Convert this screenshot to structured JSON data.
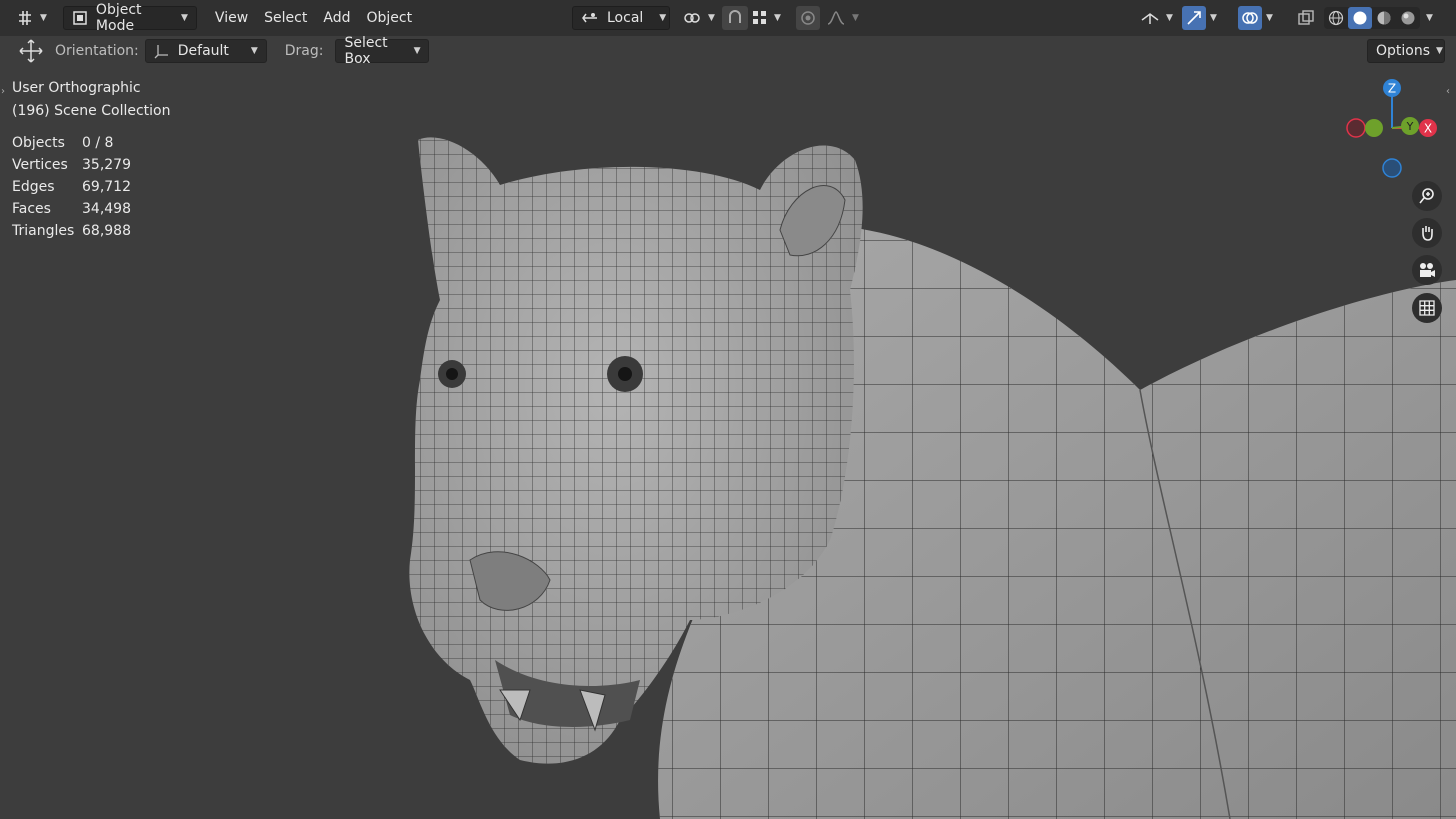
{
  "header": {
    "mode_label": "Object Mode",
    "menu": [
      "View",
      "Select",
      "Add",
      "Object"
    ],
    "pivot_label": "Local"
  },
  "tool_settings": {
    "orientation_label": "Orientation:",
    "orientation_value": "Default",
    "drag_label": "Drag:",
    "drag_value": "Select Box",
    "options_label": "Options"
  },
  "viewport": {
    "view_name": "User Orthographic",
    "collection": "(196) Scene Collection",
    "stats": [
      {
        "label": "Objects",
        "value": "0 / 8"
      },
      {
        "label": "Vertices",
        "value": "35,279"
      },
      {
        "label": "Edges",
        "value": "69,712"
      },
      {
        "label": "Faces",
        "value": "34,498"
      },
      {
        "label": "Triangles",
        "value": "68,988"
      }
    ]
  },
  "gizmo": {
    "z_label": "Z",
    "y_label": "Y",
    "x_label": "X",
    "colors": {
      "x": "#e0334a",
      "y": "#6ea12b",
      "z": "#2f83d6"
    }
  },
  "icons": {
    "editor_type": "editor-type-icon",
    "object_mode": "object-mode-icon",
    "transform_pivot": "pivot-icon",
    "snap": "snap-icon",
    "proportional": "proportional-icon",
    "zoom": "zoom-icon",
    "pan": "hand-icon",
    "camera": "camera-icon",
    "grid": "grid-icon"
  }
}
